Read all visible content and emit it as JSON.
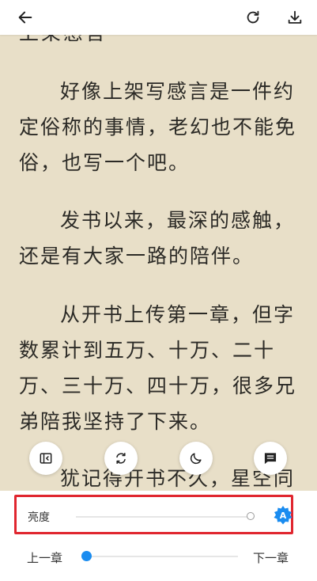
{
  "topbar": {
    "back_icon": "arrow-left-icon",
    "refresh_icon": "refresh-icon",
    "download_icon": "download-icon"
  },
  "reader": {
    "clipped_top_line": "上架感言",
    "paragraphs": [
      "好像上架写感言是一件约定俗称的事情，老幻也不能免俗，也写一个吧。",
      "发书以来，最深的感触，还是有大家一路的陪伴。",
      "从开书上传第一章，但字数累计到五万、十万、二十万、三十万、四十万，很多兄弟陪我坚持了下来。",
      "犹记得开书不久，星空同"
    ]
  },
  "fabs": [
    {
      "icon": "exit-layout-icon"
    },
    {
      "icon": "rotate-icon"
    },
    {
      "icon": "night-mode-icon"
    },
    {
      "icon": "comment-icon"
    }
  ],
  "panel": {
    "brightness_label": "亮度",
    "brightness_level": 0.96,
    "auto_brightness_letter": "A",
    "prev_chapter_label": "上一章",
    "next_chapter_label": "下一章",
    "chapter_progress": 0.0
  },
  "colors": {
    "page_bg": "#e8dfc8",
    "text": "#2b2a26",
    "accent_blue": "#1a8cf0",
    "highlight_red": "#e0262f"
  }
}
